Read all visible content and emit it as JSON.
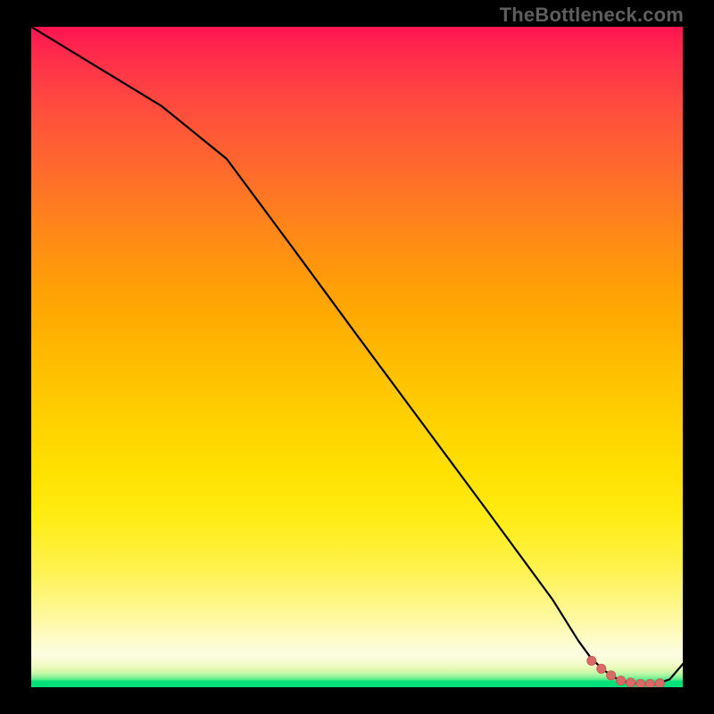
{
  "watermark": "TheBottleneck.com",
  "colors": {
    "line": "#000000",
    "marker_fill": "#d96a65",
    "marker_stroke": "#c65a55"
  },
  "chart_data": {
    "type": "line",
    "title": "",
    "xlabel": "",
    "ylabel": "",
    "xlim": [
      0,
      100
    ],
    "ylim": [
      0,
      100
    ],
    "grid": false,
    "series": [
      {
        "name": "curve",
        "x": [
          0,
          10,
          20,
          30,
          40,
          50,
          60,
          70,
          80,
          84,
          86,
          88,
          90,
          92,
          94,
          96,
          98,
          100
        ],
        "y": [
          100,
          94.0,
          88.0,
          80.0,
          66.7,
          53.3,
          40.0,
          26.7,
          13.3,
          7.0,
          4.3,
          2.5,
          1.2,
          0.6,
          0.5,
          0.5,
          1.2,
          3.5
        ]
      }
    ],
    "markers": {
      "note": "approximate highlighted segment near the trough",
      "x": [
        86,
        87.5,
        89,
        90.5,
        92,
        93.5,
        95,
        96.5
      ],
      "y": [
        4.0,
        2.8,
        1.8,
        1.0,
        0.7,
        0.5,
        0.5,
        0.6
      ]
    }
  }
}
